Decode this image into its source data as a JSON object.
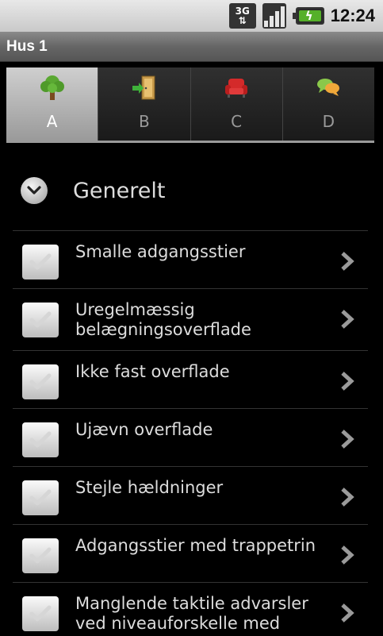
{
  "status_bar": {
    "network": "3G",
    "time": "12:24"
  },
  "title_bar": {
    "title": "Hus 1"
  },
  "tabs": [
    {
      "label": "A",
      "icon": "tree-icon",
      "active": true
    },
    {
      "label": "B",
      "icon": "door-exit-icon",
      "active": false
    },
    {
      "label": "C",
      "icon": "armchair-icon",
      "active": false
    },
    {
      "label": "D",
      "icon": "chat-bubbles-icon",
      "active": false
    }
  ],
  "section": {
    "title": "Generelt",
    "icon": "chevron-down-icon"
  },
  "items": [
    {
      "label": "Smalle adgangsstier"
    },
    {
      "label": "Uregelmæssig belægningsoverflade"
    },
    {
      "label": "Ikke fast overflade"
    },
    {
      "label": "Ujævn overflade"
    },
    {
      "label": "Stejle hældninger"
    },
    {
      "label": "Adgangsstier med trappetrin"
    },
    {
      "label": "Manglende taktile advarsler ved niveauforskelle med"
    }
  ],
  "colors": {
    "background": "#000000",
    "text": "#dddddd",
    "active_tab": "#cfcfcf",
    "battery": "#55b02a"
  }
}
